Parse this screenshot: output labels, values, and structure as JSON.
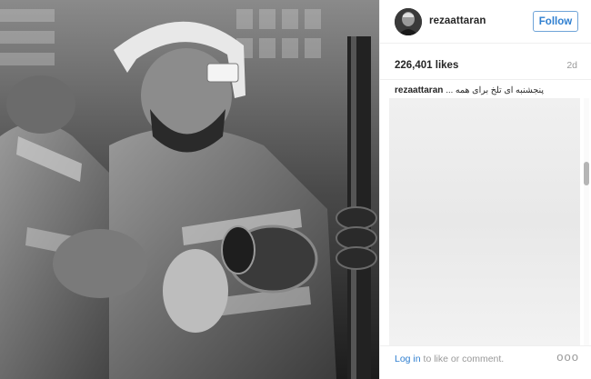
{
  "post": {
    "photo_icon": "photo-firefighters",
    "avatar_icon": "avatar-icon",
    "username": "rezaattaran",
    "follow_label": "Follow",
    "likes": "226,401 likes",
    "age": "2d",
    "caption_user": "rezaattaran",
    "caption_text": "پنجشنبه ای تلخ برای همه ...",
    "login_link": "Log in",
    "login_rest": " to like or comment.",
    "more_label": "ooo",
    "colors": {
      "accent": "#2f7fd0",
      "muted": "#999999",
      "border": "#efefef"
    }
  }
}
